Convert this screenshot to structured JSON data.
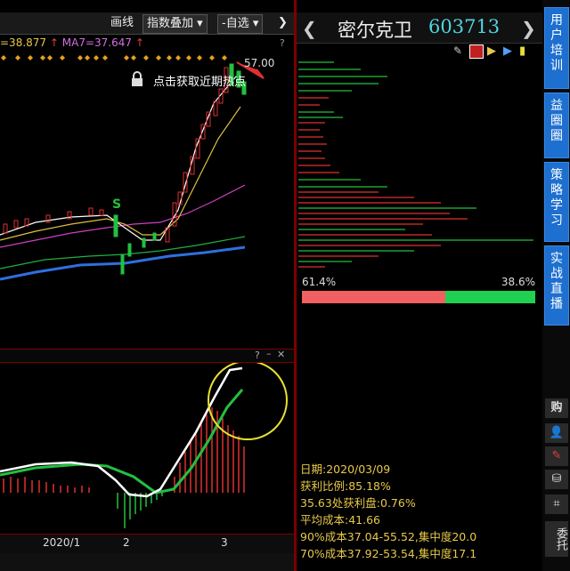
{
  "toolbar": {
    "draw_label": "画线",
    "indicator_overlay_label": "指数叠加",
    "custom_label": "自选",
    "close_label": "✕"
  },
  "ma_line": {
    "ma_prev": "=38.877",
    "ma7": "MA7=37.647"
  },
  "chart": {
    "price_max": "57.00",
    "hint": "点击获取近期热点",
    "s_marker": "S",
    "axis_labels": [
      "2020/1",
      "2",
      "3"
    ]
  },
  "stock": {
    "name": "密尔克卫",
    "code": "603713"
  },
  "chip": {
    "profit_pct": "61.4%",
    "loss_pct": "38.6%",
    "profit_fraction": 0.614,
    "info": [
      "日期:2020/03/09",
      "获利比例:85.18%",
      "35.63处获利盘:0.76%",
      "平均成本:41.66",
      "90%成本37.04-55.52,集中度20.0",
      "70%成本37.92-53.54,集中度17.1"
    ]
  },
  "sidebar": {
    "tabs": [
      "用户培训",
      "益圈圈",
      "策略学习",
      "实战直播"
    ],
    "buy_label": "购",
    "entrust_label": "委托"
  },
  "colors": {
    "red": "#e03030",
    "green": "#22c040",
    "accent_blue": "#1d6fd0"
  }
}
